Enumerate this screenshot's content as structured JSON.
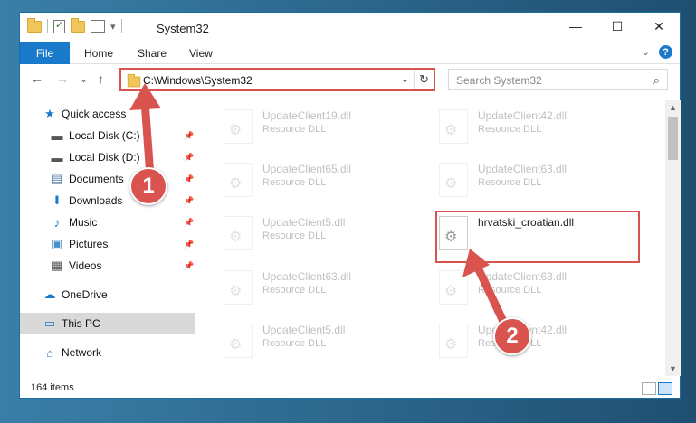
{
  "window": {
    "title": "System32",
    "min_glyph": "—",
    "max_glyph": "☐",
    "close_glyph": "✕"
  },
  "ribbon": {
    "tabs": [
      "File",
      "Home",
      "Share",
      "View"
    ],
    "expand_glyph": "⌄",
    "help_glyph": "?"
  },
  "nav": {
    "back_glyph": "←",
    "forward_glyph": "→",
    "recent_glyph": "⌄",
    "up_glyph": "↑",
    "address": "C:\\Windows\\System32",
    "address_drop_glyph": "⌄",
    "refresh_glyph": "↻",
    "search_placeholder": "Search System32",
    "search_glyph": "⌕"
  },
  "sidebar": {
    "items": [
      {
        "label": "Quick access",
        "icon": "star-icon",
        "glyph": "★",
        "color": "#1979ca",
        "pinned": false
      },
      {
        "label": "Local Disk (C:)",
        "icon": "drive-icon",
        "glyph": "▬",
        "color": "#555555",
        "pinned": true
      },
      {
        "label": "Local Disk (D:)",
        "icon": "drive-icon",
        "glyph": "▬",
        "color": "#555555",
        "pinned": true
      },
      {
        "label": "Documents",
        "icon": "documents-icon",
        "glyph": "▤",
        "color": "#5b7fa6",
        "pinned": true
      },
      {
        "label": "Downloads",
        "icon": "downloads-icon",
        "glyph": "⬇",
        "color": "#1979ca",
        "pinned": true
      },
      {
        "label": "Music",
        "icon": "music-icon",
        "glyph": "♪",
        "color": "#1979ca",
        "pinned": true
      },
      {
        "label": "Pictures",
        "icon": "pictures-icon",
        "glyph": "▣",
        "color": "#4a8fc7",
        "pinned": true
      },
      {
        "label": "Videos",
        "icon": "videos-icon",
        "glyph": "▦",
        "color": "#555555",
        "pinned": true
      },
      {
        "label": "OneDrive",
        "icon": "cloud-icon",
        "glyph": "☁",
        "color": "#1979ca",
        "pinned": false
      },
      {
        "label": "This PC",
        "icon": "pc-icon",
        "glyph": "▭",
        "color": "#1979ca",
        "pinned": false,
        "selected": true
      },
      {
        "label": "Network",
        "icon": "network-icon",
        "glyph": "⌂",
        "color": "#1979ca",
        "pinned": false
      }
    ],
    "pin_glyph": "📌"
  },
  "files": {
    "left_column": [
      {
        "name": "UpdateClient19.dll",
        "type": "Resource DLL"
      },
      {
        "name": "UpdateClient65.dll",
        "type": "Resource DLL"
      },
      {
        "name": "UpdateClient5.dll",
        "type": "Resource DLL"
      },
      {
        "name": "UpdateClient63.dll",
        "type": "Resource DLL"
      },
      {
        "name": "UpdateClient5.dll",
        "type": "Resource DLL"
      }
    ],
    "right_column": [
      {
        "name": "UpdateClient42.dll",
        "type": "Resource DLL",
        "faded": true
      },
      {
        "name": "UpdateClient63.dll",
        "type": "Resource DLL",
        "faded": true
      },
      {
        "name": "hrvatski_croatian.dll",
        "type": "",
        "faded": false
      },
      {
        "name": "UpdateClient63.dll",
        "type": "Resource DLL",
        "faded": true
      },
      {
        "name": "UpdateClient42.dll",
        "type": "Resource DLL",
        "faded": true
      }
    ]
  },
  "scroll": {
    "up_glyph": "▲",
    "down_glyph": "▼"
  },
  "status": {
    "items_count": "164 items"
  },
  "annotations": {
    "step1": "1",
    "step2": "2",
    "accent": "#d9534f"
  }
}
